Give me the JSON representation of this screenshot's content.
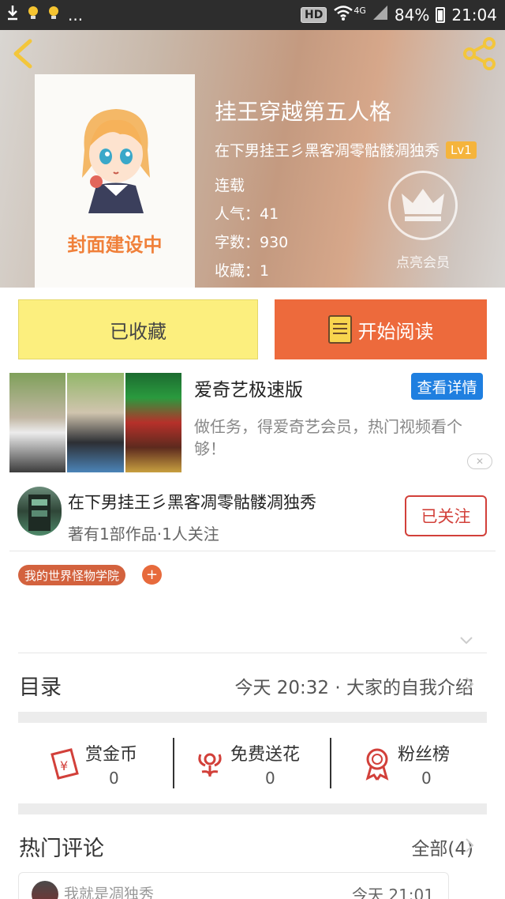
{
  "status_bar": {
    "left_more": "...",
    "hd": "HD",
    "network": "4G",
    "battery": "84%",
    "time": "21:04"
  },
  "book": {
    "cover_text": "封面建设中",
    "title": "挂王穿越第五人格",
    "author": "在下男挂王彡黑客凋零骷髅凋独秀",
    "level": "Lv1",
    "status": "连载",
    "popularity": "人气：41",
    "word_count": "字数：930",
    "favorites": "收藏：1",
    "vip_label": "点亮会员"
  },
  "actions": {
    "collected_label": "已收藏",
    "read_label": "开始阅读"
  },
  "ad": {
    "title": "爱奇艺极速版",
    "detail_label": "查看详情",
    "description": "做任务，得爱奇艺会员，热门视频看个够！",
    "close": "✕"
  },
  "author_card": {
    "name": "在下男挂王彡黑客凋零骷髅凋独秀",
    "stats": "著有1部作品·1人关注",
    "follow_label": "已关注"
  },
  "tags": {
    "items": [
      "我的世界怪物学院"
    ],
    "add": "+"
  },
  "catalog": {
    "label": "目录",
    "latest": "今天 20:32 · 大家的自我介绍"
  },
  "stats": [
    {
      "label": "赏金币",
      "value": "0",
      "icon": "reward-coin-icon"
    },
    {
      "label": "免费送花",
      "value": "0",
      "icon": "flower-icon"
    },
    {
      "label": "粉丝榜",
      "value": "0",
      "icon": "medal-icon"
    }
  ],
  "comments": {
    "label": "热门评论",
    "all": "全部(4)",
    "items": [
      {
        "name": "我就是凋独秀",
        "time": "今天 21:01"
      }
    ]
  },
  "colors": {
    "accent_orange": "#ed6a3c",
    "collected_yellow": "#fcef7e",
    "follow_red": "#d2403a",
    "ad_blue": "#1f7fe0"
  }
}
